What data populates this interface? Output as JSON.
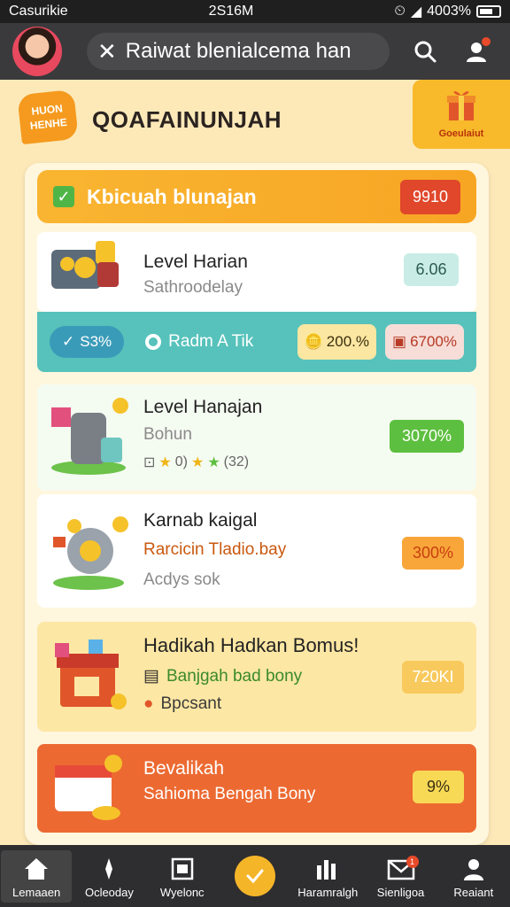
{
  "status_bar": {
    "carrier": "Casurikie",
    "time": "2S16M",
    "battery": "4003%"
  },
  "header": {
    "search_text": "Raiwat blenialcema han"
  },
  "title_row": {
    "badge": "HUON HENHE",
    "title": "QOAFAINUNJAH",
    "gift_label": "Goeulaiut"
  },
  "card": {
    "header_title": "Kbicuah blunajan",
    "header_value": "9910",
    "items": [
      {
        "title": "Level Harian",
        "sub": "Sathroodelay",
        "value": "6.06",
        "icon": "coins-pots-icon"
      },
      {
        "title": "Level Hanajan",
        "sub": "Bohun",
        "value": "3070%",
        "rating_text": "0)",
        "rating_count": "(32)",
        "icon": "canister-icon"
      },
      {
        "title": "Karnab kaigal",
        "sub": "Rarcicin Tladio.bay",
        "sub2": "Acdys sok",
        "value": "300%",
        "icon": "coin-wheel-icon"
      },
      {
        "title": "Hadikah Hadkan Bomus!",
        "sub": "Banjgah bad bony",
        "sub2": "Bpcsant",
        "value": "720KI",
        "icon": "gift-shop-icon"
      },
      {
        "title": "Bevalikah",
        "sub": "Sahioma Bengah Bony",
        "value": "9%",
        "icon": "calendar-coins-icon"
      }
    ],
    "teal_bar": {
      "pct": "S3%",
      "label": "Radm A Tik",
      "chip1": "200.%",
      "chip2": "6700%"
    }
  },
  "bottom_nav": [
    {
      "label": "Lemaaen",
      "icon": "home-icon"
    },
    {
      "label": "Ocleoday",
      "icon": "compass-icon"
    },
    {
      "label": "Wyelonc",
      "icon": "calendar-icon"
    },
    {
      "label": "",
      "icon": "check-fab-icon"
    },
    {
      "label": "Haramralgh",
      "icon": "chart-icon"
    },
    {
      "label": "Sienligoa",
      "icon": "mail-icon",
      "badge": "1"
    },
    {
      "label": "Reaiant",
      "icon": "profile-icon"
    }
  ]
}
